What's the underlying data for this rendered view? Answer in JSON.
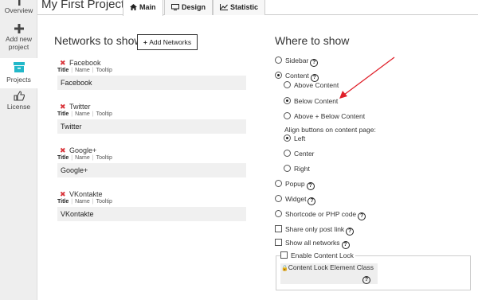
{
  "sidebar": {
    "items": [
      {
        "label": "Overview",
        "icon": "info-icon"
      },
      {
        "label": "Add new project",
        "icon": "plus-icon"
      },
      {
        "label": "Projects",
        "icon": "archive-icon"
      },
      {
        "label": "License",
        "icon": "thumbs-up-icon"
      }
    ]
  },
  "header": {
    "title": "My First Project",
    "tabs": [
      {
        "label": "Main",
        "icon": "home-icon"
      },
      {
        "label": "Design",
        "icon": "monitor-icon"
      },
      {
        "label": "Statistic",
        "icon": "chart-icon"
      }
    ]
  },
  "networks": {
    "heading": "Networks to show",
    "add_button": "Add Networks",
    "subtabs": {
      "title": "Title",
      "name": "Name",
      "tooltip": "Tooltip"
    },
    "items": [
      {
        "name": "Facebook",
        "value": "Facebook"
      },
      {
        "name": "Twitter",
        "value": "Twitter"
      },
      {
        "name": "Google+",
        "value": "Google+"
      },
      {
        "name": "VKontakte",
        "value": "VKontakte"
      }
    ]
  },
  "where": {
    "heading": "Where to show",
    "sidebar": "Sidebar",
    "content": "Content",
    "above": "Above Content",
    "below": "Below Content",
    "above_below": "Above + Below Content",
    "align_label": "Align buttons on content page:",
    "left": "Left",
    "center": "Center",
    "right": "Right",
    "popup": "Popup",
    "widget": "Widget",
    "shortcode": "Shortcode or PHP code",
    "share_only": "Share only post link",
    "show_all": "Show all networks",
    "enable_lock": "Enable Content Lock",
    "lock_class": "Content Lock Element Class",
    "help_glyph": "?"
  },
  "colors": {
    "remove": "#d9343a",
    "arrow": "#e0202a",
    "sidebar_bg": "#eeeeee"
  }
}
